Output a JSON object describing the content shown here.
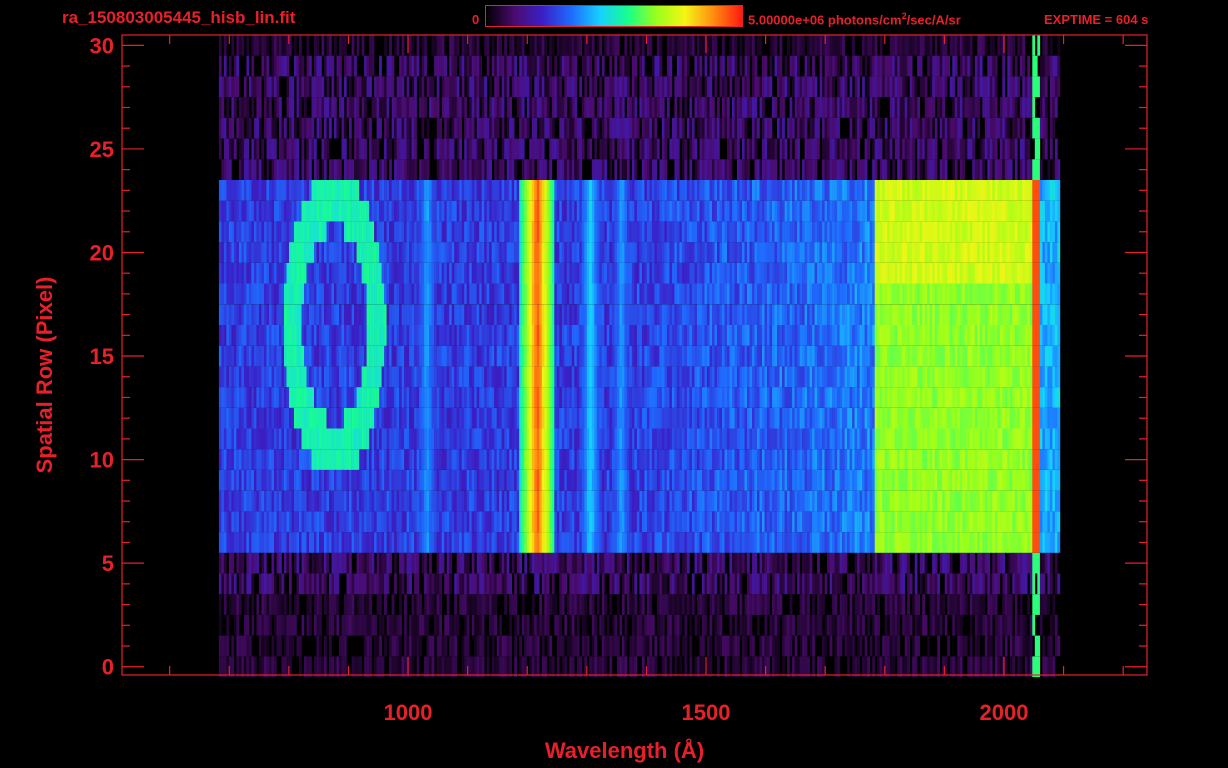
{
  "header": {
    "file_title": "ra_150803005445_hisb_lin.fit",
    "colorbar_min": "0",
    "colorbar_max_unit_pre": "5.00000e+06 photons/cm",
    "colorbar_unit_sup": "2",
    "colorbar_unit_post": "/sec/A/sr",
    "exptime": "EXPTIME = 604 s"
  },
  "colors": {
    "axes": "#e8202a",
    "background": "#000000",
    "colormap": [
      "#000000",
      "#4b0b6e",
      "#3a20c8",
      "#1f6bff",
      "#16d0ff",
      "#19ff8a",
      "#9bff1a",
      "#f5f515",
      "#ff8c10",
      "#ff1a10"
    ]
  },
  "chart_data": {
    "type": "heatmap",
    "title": "ra_150803005445_hisb_lin.fit",
    "xlabel": "Wavelength (Å)",
    "ylabel": "Spatial Row (Pixel)",
    "xlim": [
      520,
      2240
    ],
    "ylim": [
      -0.4,
      30.5
    ],
    "x_ticks": [
      1000,
      1500,
      2000
    ],
    "y_ticks": [
      0,
      5,
      10,
      15,
      20,
      25,
      30
    ],
    "colorbar": {
      "min": 0,
      "max": 5000000,
      "unit": "photons/cm^2/sec/A/sr"
    },
    "detector": {
      "wavelength_range": [
        680,
        2060
      ],
      "rows_with_signal": [
        6,
        23
      ]
    },
    "features": [
      {
        "name": "ring",
        "wavelength_center": 875,
        "row_center": 16.5,
        "wavelength_radius": 70,
        "row_radius": 6,
        "intensity": 0.55
      },
      {
        "name": "line",
        "wavelength": 1030,
        "width": 14,
        "intensity": 0.42
      },
      {
        "name": "line",
        "wavelength": 1215,
        "width": 22,
        "intensity": 0.97
      },
      {
        "name": "line",
        "wavelength": 1304,
        "width": 14,
        "intensity": 0.48
      },
      {
        "name": "line",
        "wavelength": 1356,
        "width": 14,
        "intensity": 0.42
      },
      {
        "name": "continuum",
        "wavelength_range": [
          1780,
          2060
        ],
        "intensity": 0.62
      },
      {
        "name": "edge",
        "wavelength": 2052,
        "intensity": 0.95
      }
    ]
  }
}
